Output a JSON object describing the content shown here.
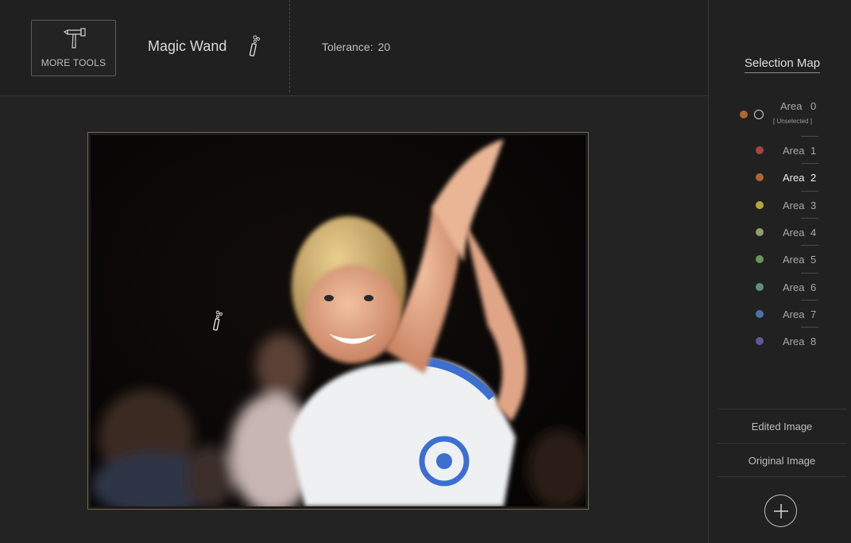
{
  "toolbar": {
    "more_tools_label": "MORE TOOLS",
    "more_tools_icon": "hammer-icon",
    "tool_name": "Magic Wand",
    "tool_icon": "magic-wand-icon",
    "tolerance_label": "Tolerance:",
    "tolerance_value": "20"
  },
  "canvas": {
    "cursor_icon": "magic-wand-cursor-icon"
  },
  "selection_map": {
    "title": "Selection Map",
    "area0": {
      "label": "Area",
      "number": "0",
      "sublabel": "[ Unselected ]",
      "color": "#b06530"
    },
    "areas": [
      {
        "label": "Area",
        "number": "1",
        "color": "#a84242",
        "active": false
      },
      {
        "label": "Area",
        "number": "2",
        "color": "#b06530",
        "active": true
      },
      {
        "label": "Area",
        "number": "3",
        "color": "#b9a43c",
        "active": false
      },
      {
        "label": "Area",
        "number": "4",
        "color": "#8fa064",
        "active": false
      },
      {
        "label": "Area",
        "number": "5",
        "color": "#67955d",
        "active": false
      },
      {
        "label": "Area",
        "number": "6",
        "color": "#5f8e82",
        "active": false
      },
      {
        "label": "Area",
        "number": "7",
        "color": "#4e72a3",
        "active": false
      },
      {
        "label": "Area",
        "number": "8",
        "color": "#5c5a98",
        "active": false
      }
    ],
    "edited_image_label": "Edited Image",
    "original_image_label": "Original Image",
    "add_icon": "plus-circle-icon"
  }
}
